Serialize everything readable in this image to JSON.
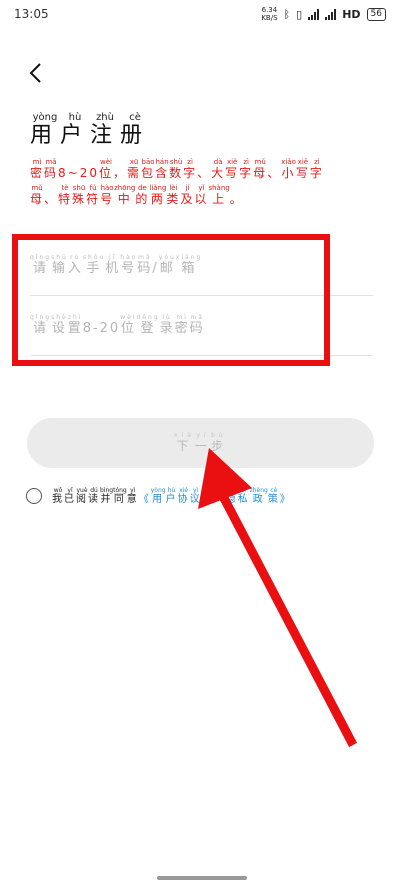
{
  "status_bar": {
    "time": "13:05",
    "speed_value": "6.34",
    "speed_unit": "KB/S",
    "network": "HD",
    "battery": "56"
  },
  "header": {
    "back_icon": "chevron-left-icon",
    "title_chars": [
      "用",
      "户",
      "注",
      "册"
    ],
    "title_pinyin": [
      "yòng",
      "hù",
      "zhù",
      "cè"
    ]
  },
  "rules": {
    "line1": [
      [
        "密",
        "mì"
      ],
      [
        "码",
        "mǎ"
      ],
      [
        "8~20",
        ""
      ],
      [
        "位",
        "wèi"
      ],
      [
        "，",
        ""
      ],
      [
        "需",
        "xū"
      ],
      [
        "包",
        "bāo"
      ],
      [
        "含",
        "hán"
      ],
      [
        "数",
        "shù"
      ],
      [
        "字",
        "zì"
      ],
      [
        "、",
        ""
      ],
      [
        "大",
        "dà"
      ],
      [
        "写",
        "xiě"
      ],
      [
        "字",
        "zì"
      ],
      [
        "母",
        "mǔ"
      ],
      [
        "、",
        ""
      ],
      [
        "小",
        "xiǎo"
      ],
      [
        "写",
        "xiě"
      ],
      [
        "字",
        "zì"
      ]
    ],
    "line2": [
      [
        "母",
        "mǔ"
      ],
      [
        "、",
        ""
      ],
      [
        "特",
        "tè"
      ],
      [
        "殊",
        "shū"
      ],
      [
        "符",
        "fú"
      ],
      [
        "号",
        "hào"
      ],
      [
        "中",
        "zhōng"
      ],
      [
        "的",
        "de"
      ],
      [
        "两",
        "liǎng"
      ],
      [
        "类",
        "lèi"
      ],
      [
        "及",
        "jí"
      ],
      [
        "以",
        "yǐ"
      ],
      [
        "上",
        "shàng"
      ],
      [
        "。",
        ""
      ]
    ]
  },
  "form": {
    "phone_placeholder": [
      [
        "请",
        "qǐng"
      ],
      [
        "输",
        "shū"
      ],
      [
        "入",
        "rù"
      ],
      [
        "手",
        "shǒu"
      ],
      [
        "机",
        "jī"
      ],
      [
        "号",
        "hào"
      ],
      [
        "码",
        "mǎ"
      ],
      [
        "/",
        ""
      ],
      [
        "邮",
        "yóu"
      ],
      [
        "箱",
        "xiāng"
      ]
    ],
    "password_placeholder": [
      [
        "请",
        "qǐng"
      ],
      [
        "设",
        "shè"
      ],
      [
        "置",
        "zhì"
      ],
      [
        "8-20",
        ""
      ],
      [
        "位",
        "wèi"
      ],
      [
        "登",
        "dēng"
      ],
      [
        "录",
        "lù"
      ],
      [
        "密",
        "mì"
      ],
      [
        "码",
        "mǎ"
      ]
    ]
  },
  "next_button": [
    [
      "下",
      "xià"
    ],
    [
      "一",
      "yí"
    ],
    [
      "步",
      "bù"
    ]
  ],
  "agreement": {
    "prefix": [
      [
        "我",
        "wǒ"
      ],
      [
        "已",
        "yǐ"
      ],
      [
        "阅",
        "yuè"
      ],
      [
        "读",
        "dú"
      ],
      [
        "并",
        "bìng"
      ],
      [
        "同",
        "tóng"
      ],
      [
        "意",
        "yì"
      ]
    ],
    "user_agreement": [
      [
        "《",
        ""
      ],
      [
        "用",
        "yòng"
      ],
      [
        "户",
        "hù"
      ],
      [
        "协",
        "xié"
      ],
      [
        "议",
        "yì"
      ],
      [
        "》",
        ""
      ]
    ],
    "privacy_policy": [
      [
        "《",
        ""
      ],
      [
        "隐",
        "yǐn"
      ],
      [
        "私",
        "sī"
      ],
      [
        "政",
        "zhèng"
      ],
      [
        "策",
        "cè"
      ],
      [
        "》",
        ""
      ]
    ]
  },
  "colors": {
    "annotation_red": "#ea0f10",
    "rule_text": "#e31b1b",
    "link_blue": "#1f8ee0"
  }
}
